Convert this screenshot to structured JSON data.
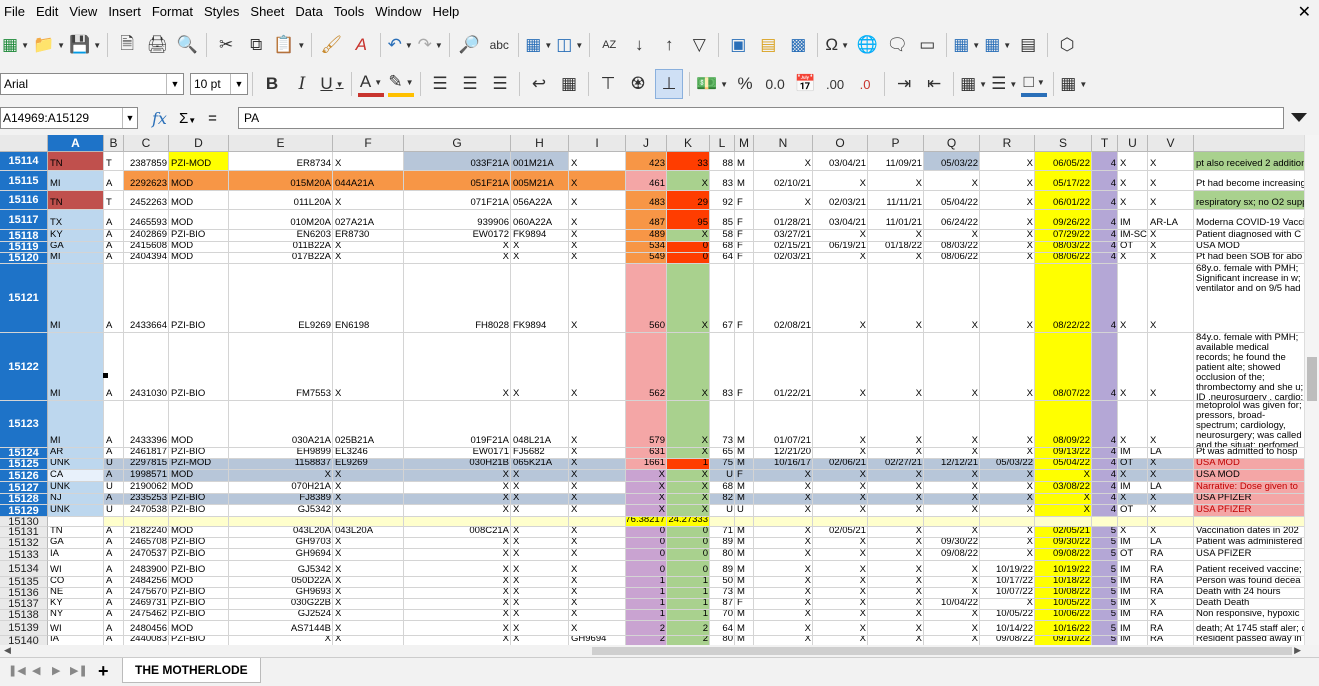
{
  "menu": [
    "File",
    "Edit",
    "View",
    "Insert",
    "Format",
    "Styles",
    "Sheet",
    "Data",
    "Tools",
    "Window",
    "Help"
  ],
  "font": {
    "name": "Arial",
    "size": "10 pt"
  },
  "namebox": "A14969:A15129",
  "formula": "PA",
  "sheet_tab": "THE MOTHERLODE",
  "columns": [
    "A",
    "B",
    "C",
    "D",
    "E",
    "F",
    "G",
    "H",
    "I",
    "J",
    "K",
    "L",
    "M",
    "N",
    "O",
    "P",
    "Q",
    "R",
    "S",
    "T",
    "U",
    "V"
  ],
  "selected_column": "A",
  "colors": {
    "selection": "#1e73c8",
    "red": "#c0504d",
    "blue_light": "#bdd7ee",
    "yellow": "#ffff00",
    "orange": "#f79646",
    "salmon": "#f4a6a6",
    "green": "#a9d18e",
    "lavender": "#b4a7d6",
    "purple": "#c9a3d1",
    "gray_band": "#b7c6d9",
    "tomato": "#ff3d00"
  },
  "rows": [
    {
      "num": "15114",
      "cells": {
        "A": "TN",
        "B": "T",
        "C": "2387859",
        "D": "PZI-MOD",
        "E": "ER8734",
        "F": "X",
        "G": "033F21A",
        "H": "001M21A",
        "I": "X",
        "J": "423",
        "K": "33",
        "L": "88",
        "M": "M",
        "N": "X",
        "O": "03/04/21",
        "P": "11/09/21",
        "Q": "05/03/22",
        "R": "X",
        "S": "06/05/22",
        "T": "4",
        "U": "X",
        "V": "X",
        "W": "pt also received 2 additional doses; hemorrhage; DNR; High lactate"
      }
    },
    {
      "num": "15115",
      "cells": {
        "A": "MI",
        "B": "A",
        "C": "2292623",
        "D": "MOD",
        "E": "015M20A",
        "F": "044A21A",
        "G": "051F21A",
        "H": "005M21A",
        "I": "X",
        "J": "461",
        "K": "X",
        "L": "83",
        "M": "M",
        "N": "02/10/21",
        "O": "X",
        "P": "X",
        "Q": "X",
        "R": "X",
        "S": "05/17/22",
        "T": "4",
        "U": "X",
        "V": "X",
        "W": "Pt had become increasingly weak; went into PEA arrest and"
      }
    },
    {
      "num": "15116",
      "cells": {
        "A": "TN",
        "B": "T",
        "C": "2452263",
        "D": "MOD",
        "E": "011L20A",
        "F": "X",
        "G": "071F21A",
        "H": "056A22A",
        "I": "X",
        "J": "483",
        "K": "29",
        "L": "92",
        "M": "F",
        "N": "X",
        "O": "02/03/21",
        "P": "11/11/21",
        "Q": "05/04/22",
        "R": "X",
        "S": "06/01/22",
        "T": "4",
        "U": "X",
        "V": "X",
        "W": "respiratory sx; no O2 support; passed away on 6/28/22"
      }
    },
    {
      "num": "15117",
      "cells": {
        "A": "TX",
        "B": "A",
        "C": "2465593",
        "D": "MOD",
        "E": "010M20A",
        "F": "027A21A",
        "G": "939906",
        "H": "060A22A",
        "I": "X",
        "J": "487",
        "K": "95",
        "L": "85",
        "M": "F",
        "N": "01/28/21",
        "O": "03/04/21",
        "P": "11/01/21",
        "Q": "06/24/22",
        "R": "X",
        "S": "09/26/22",
        "T": "4",
        "U": "IM",
        "V": "AR-LA",
        "W": "Moderna COVID-19 Vaccine; transfer she became pro"
      }
    },
    {
      "num": "15118",
      "cells": {
        "A": "KY",
        "B": "A",
        "C": "2402869",
        "D": "PZI-BIO",
        "E": "EN6203",
        "F": "ER8730",
        "G": "EW0172",
        "H": "FK9894",
        "I": "X",
        "J": "489",
        "K": "X",
        "L": "58",
        "M": "F",
        "N": "03/27/21",
        "O": "X",
        "P": "X",
        "Q": "X",
        "R": "X",
        "S": "07/29/22",
        "T": "4",
        "U": "IM-SC",
        "V": "X",
        "W": "Patient diagnosed with C"
      }
    },
    {
      "num": "15119",
      "cells": {
        "A": "GA",
        "B": "A",
        "C": "2415608",
        "D": "MOD",
        "E": "011B22A",
        "F": "X",
        "G": "X",
        "H": "X",
        "I": "X",
        "J": "534",
        "K": "0",
        "L": "68",
        "M": "F",
        "N": "02/15/21",
        "O": "06/19/21",
        "P": "01/18/22",
        "Q": "08/03/22",
        "R": "X",
        "S": "08/03/22",
        "T": "4",
        "U": "OT",
        "V": "X",
        "W": "USA MOD"
      }
    },
    {
      "num": "15120",
      "cells": {
        "A": "MI",
        "B": "A",
        "C": "2404394",
        "D": "MOD",
        "E": "017B22A",
        "F": "X",
        "G": "X",
        "H": "X",
        "I": "X",
        "J": "549",
        "K": "0",
        "L": "64",
        "M": "F",
        "N": "02/03/21",
        "O": "X",
        "P": "X",
        "Q": "08/06/22",
        "R": "X",
        "S": "08/06/22",
        "T": "4",
        "U": "X",
        "V": "X",
        "W": "Pt had been SOB for abo"
      }
    },
    {
      "num": "15121",
      "cells": {
        "A": "MI",
        "B": "A",
        "C": "2433664",
        "D": "PZI-BIO",
        "E": "EL9269",
        "F": "EN6198",
        "G": "FH8028",
        "H": "FK9894",
        "I": "X",
        "J": "560",
        "K": "X",
        "L": "67",
        "M": "F",
        "N": "02/08/21",
        "O": "X",
        "P": "X",
        "Q": "X",
        "R": "X",
        "S": "08/22/22",
        "T": "4",
        "U": "X",
        "V": "X",
        "W": "68y.o. female with PMH; Significant increase in w; ventilator and on 9/5 had"
      }
    },
    {
      "num": "15122",
      "cells": {
        "A": "MI",
        "B": "A",
        "C": "2431030",
        "D": "PZI-BIO",
        "E": "FM7553",
        "F": "X",
        "G": "X",
        "H": "X",
        "I": "X",
        "J": "562",
        "K": "X",
        "L": "83",
        "M": "F",
        "N": "01/22/21",
        "O": "X",
        "P": "X",
        "Q": "X",
        "R": "X",
        "S": "08/07/22",
        "T": "4",
        "U": "X",
        "V": "X",
        "W": "84y.o. female with PMH; available medical records; he found the patient alte; showed occlusion of the; thrombectomy and she u; ID ,neurosurgery , cardio; here , overall very poor p"
      }
    },
    {
      "num": "15123",
      "cells": {
        "A": "MI",
        "B": "A",
        "C": "2433396",
        "D": "MOD",
        "E": "030A21A",
        "F": "025B21A",
        "G": "019F21A",
        "H": "048L21A",
        "I": "X",
        "J": "579",
        "K": "X",
        "L": "73",
        "M": "M",
        "N": "01/07/21",
        "O": "X",
        "P": "X",
        "Q": "X",
        "R": "X",
        "S": "08/09/22",
        "T": "4",
        "U": "X",
        "V": "X",
        "W": "metoprolol was given for; pressors, broad-spectrum; cardiology, neurosurgery; was called and the situat; perfomed on 8/10 at 140"
      }
    },
    {
      "num": "15124",
      "cells": {
        "A": "AR",
        "B": "A",
        "C": "2461817",
        "D": "PZI-BIO",
        "E": "EH9899",
        "F": "EL3246",
        "G": "EW0171",
        "H": "FJ5682",
        "I": "X",
        "J": "631",
        "K": "X",
        "L": "65",
        "M": "M",
        "N": "12/21/20",
        "O": "X",
        "P": "X",
        "Q": "X",
        "R": "X",
        "S": "09/13/22",
        "T": "4",
        "U": "IM",
        "V": "LA",
        "W": "Pt was admitted to hosp"
      }
    },
    {
      "num": "15125",
      "cells": {
        "A": "UNK",
        "B": "U",
        "C": "2297815",
        "D": "PZI-MOD",
        "E": "1158837",
        "F": "EL9269",
        "G": "030H21B",
        "H": "065K21A",
        "I": "X",
        "J": "1661",
        "K": "1",
        "L": "75",
        "M": "M",
        "N": "10/16/17",
        "O": "02/06/21",
        "P": "02/27/21",
        "Q": "12/12/21",
        "R": "05/03/22",
        "S": "05/04/22",
        "T": "4",
        "U": "OT",
        "V": "X",
        "W": "USA MOD"
      }
    },
    {
      "num": "15126",
      "cells": {
        "A": "CA",
        "B": "A",
        "C": "1998571",
        "D": "MOD",
        "E": "X",
        "F": "X",
        "G": "X",
        "H": "X",
        "I": "X",
        "J": "X",
        "K": "X",
        "L": "U",
        "M": "F",
        "N": "X",
        "O": "X",
        "P": "X",
        "Q": "X",
        "R": "X",
        "S": "X",
        "T": "4",
        "U": "X",
        "V": "X",
        "W": "USA MOD"
      }
    },
    {
      "num": "15127",
      "cells": {
        "A": "UNK",
        "B": "U",
        "C": "2190062",
        "D": "MOD",
        "E": "070H21A",
        "F": "X",
        "G": "X",
        "H": "X",
        "I": "X",
        "J": "X",
        "K": "X",
        "L": "68",
        "M": "M",
        "N": "X",
        "O": "X",
        "P": "X",
        "Q": "X",
        "R": "X",
        "S": "03/08/22",
        "T": "4",
        "U": "IM",
        "V": "LA",
        "W": "Narrative: Dose given to"
      }
    },
    {
      "num": "15128",
      "cells": {
        "A": "NJ",
        "B": "A",
        "C": "2335253",
        "D": "PZI-BIO",
        "E": "FJ8389",
        "F": "X",
        "G": "X",
        "H": "X",
        "I": "X",
        "J": "X",
        "K": "X",
        "L": "82",
        "M": "M",
        "N": "X",
        "O": "X",
        "P": "X",
        "Q": "X",
        "R": "X",
        "S": "X",
        "T": "4",
        "U": "X",
        "V": "X",
        "W": "USA PFIZER"
      }
    },
    {
      "num": "15129",
      "cells": {
        "A": "UNK",
        "B": "U",
        "C": "2470538",
        "D": "PZI-BIO",
        "E": "GJ5342",
        "F": "X",
        "G": "X",
        "H": "X",
        "I": "X",
        "J": "X",
        "K": "X",
        "L": "U",
        "M": "U",
        "N": "X",
        "O": "X",
        "P": "X",
        "Q": "X",
        "R": "X",
        "S": "X",
        "T": "4",
        "U": "OT",
        "V": "X",
        "W": "USA PFIZER"
      }
    },
    {
      "num": "15130",
      "cells": {
        "J": "76.38217",
        "K": "24.27333"
      }
    },
    {
      "num": "15131",
      "cells": {
        "A": "TN",
        "B": "A",
        "C": "2182240",
        "D": "MOD",
        "E": "043L20A",
        "F": "043L20A",
        "G": "008C21A",
        "H": "X",
        "I": "X",
        "J": "0",
        "K": "0",
        "L": "71",
        "M": "M",
        "N": "X",
        "O": "02/05/21",
        "P": "X",
        "Q": "X",
        "R": "X",
        "S": "02/05/21",
        "T": "5",
        "U": "X",
        "V": "X",
        "W": "Vaccination dates in 202"
      }
    },
    {
      "num": "15132",
      "cells": {
        "A": "GA",
        "B": "A",
        "C": "2465708",
        "D": "PZI-BIO",
        "E": "GH9703",
        "F": "X",
        "G": "X",
        "H": "X",
        "I": "X",
        "J": "0",
        "K": "0",
        "L": "89",
        "M": "M",
        "N": "X",
        "O": "X",
        "P": "X",
        "Q": "09/30/22",
        "R": "X",
        "S": "09/30/22",
        "T": "5",
        "U": "IM",
        "V": "LA",
        "W": "Patient was administered"
      }
    },
    {
      "num": "15133",
      "cells": {
        "A": "IA",
        "B": "A",
        "C": "2470537",
        "D": "PZI-BIO",
        "E": "GH9694",
        "F": "X",
        "G": "X",
        "H": "X",
        "I": "X",
        "J": "0",
        "K": "0",
        "L": "80",
        "M": "M",
        "N": "X",
        "O": "X",
        "P": "X",
        "Q": "09/08/22",
        "R": "X",
        "S": "09/08/22",
        "T": "5",
        "U": "OT",
        "V": "RA",
        "W": "USA PFIZER"
      }
    },
    {
      "num": "15134",
      "cells": {
        "A": "WI",
        "B": "A",
        "C": "2483900",
        "D": "PZI-BIO",
        "E": "GJ5342",
        "F": "X",
        "G": "X",
        "H": "X",
        "I": "X",
        "J": "0",
        "K": "0",
        "L": "89",
        "M": "M",
        "N": "X",
        "O": "X",
        "P": "X",
        "Q": "X",
        "R": "10/19/22",
        "S": "10/19/22",
        "T": "5",
        "U": "IM",
        "V": "RA",
        "W": "Patient received vaccine; approximately 12:00pm b"
      }
    },
    {
      "num": "15135",
      "cells": {
        "A": "CO",
        "B": "A",
        "C": "2484256",
        "D": "MOD",
        "E": "050D22A",
        "F": "X",
        "G": "X",
        "H": "X",
        "I": "X",
        "J": "1",
        "K": "1",
        "L": "50",
        "M": "M",
        "N": "X",
        "O": "X",
        "P": "X",
        "Q": "X",
        "R": "10/17/22",
        "S": "10/18/22",
        "T": "5",
        "U": "IM",
        "V": "RA",
        "W": "Person was found decea"
      }
    },
    {
      "num": "15136",
      "cells": {
        "A": "NE",
        "B": "A",
        "C": "2475670",
        "D": "PZI-BIO",
        "E": "GH9693",
        "F": "X",
        "G": "X",
        "H": "X",
        "I": "X",
        "J": "1",
        "K": "1",
        "L": "73",
        "M": "M",
        "N": "X",
        "O": "X",
        "P": "X",
        "Q": "X",
        "R": "10/07/22",
        "S": "10/08/22",
        "T": "5",
        "U": "IM",
        "V": "RA",
        "W": "Death with 24 hours"
      }
    },
    {
      "num": "15137",
      "cells": {
        "A": "KY",
        "B": "A",
        "C": "2469731",
        "D": "PZI-BIO",
        "E": "030G22B",
        "F": "X",
        "G": "X",
        "H": "X",
        "I": "X",
        "J": "1",
        "K": "1",
        "L": "87",
        "M": "F",
        "N": "X",
        "O": "X",
        "P": "X",
        "Q": "10/04/22",
        "R": "X",
        "S": "10/05/22",
        "T": "5",
        "U": "IM",
        "V": "X",
        "W": "Death Death"
      }
    },
    {
      "num": "15138",
      "cells": {
        "A": "NY",
        "B": "A",
        "C": "2475462",
        "D": "PZI-BIO",
        "E": "GJ2524",
        "F": "X",
        "G": "X",
        "H": "X",
        "I": "X",
        "J": "1",
        "K": "1",
        "L": "70",
        "M": "M",
        "N": "X",
        "O": "X",
        "P": "X",
        "Q": "X",
        "R": "10/05/22",
        "S": "10/06/22",
        "T": "5",
        "U": "IM",
        "V": "RA",
        "W": "Non responsive, hypoxic"
      }
    },
    {
      "num": "15139",
      "cells": {
        "A": "WI",
        "B": "A",
        "C": "2480456",
        "D": "MOD",
        "E": "AS7144B",
        "F": "X",
        "G": "X",
        "H": "X",
        "I": "X",
        "J": "2",
        "K": "2",
        "L": "64",
        "M": "M",
        "N": "X",
        "O": "X",
        "P": "X",
        "Q": "X",
        "R": "10/14/22",
        "S": "10/16/22",
        "T": "5",
        "U": "IM",
        "V": "RA",
        "W": "death; At 1745 staff aler; called. The DON was upd"
      }
    },
    {
      "num": "15140",
      "cells": {
        "A": "IA",
        "B": "A",
        "C": "2440083",
        "D": "PZI-BIO",
        "E": "X",
        "F": "X",
        "G": "X",
        "H": "X",
        "I": "GH9694",
        "J": "2",
        "K": "2",
        "L": "80",
        "M": "M",
        "N": "X",
        "O": "X",
        "P": "X",
        "Q": "X",
        "R": "09/08/22",
        "S": "09/10/22",
        "T": "5",
        "U": "IM",
        "V": "RA",
        "W": "Resident passed away in"
      }
    }
  ]
}
